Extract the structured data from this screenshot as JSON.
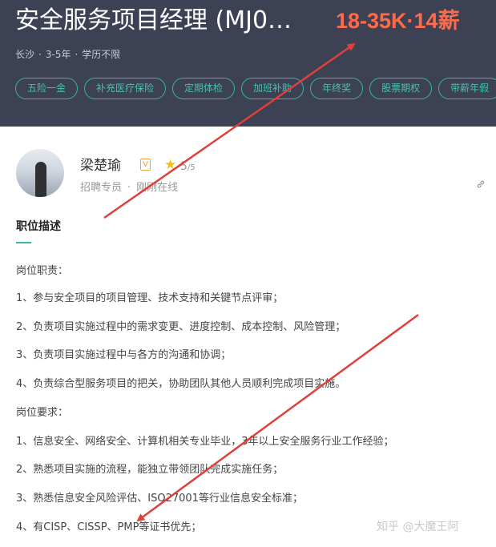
{
  "job": {
    "title": "安全服务项目经理 (MJ0…",
    "salary": "18-35K·14薪",
    "location": "长沙",
    "experience": "3-5年",
    "education": "学历不限"
  },
  "benefits": [
    "五险一金",
    "补充医疗保险",
    "定期体检",
    "加班补助",
    "年终奖",
    "股票期权",
    "带薪年假"
  ],
  "recruiter": {
    "name": "梁楚瑜",
    "rating": "5",
    "rating_max": "/5",
    "role": "招聘专员",
    "status": "刚刚在线"
  },
  "description": {
    "title": "职位描述",
    "lines": [
      "岗位职责：",
      "1、参与安全项目的项目管理、技术支持和关键节点评审；",
      "2、负责项目实施过程中的需求变更、进度控制、成本控制、风险管理；",
      "3、负责项目实施过程中与各方的沟通和协调；",
      "4、负责综合型服务项目的把关，协助团队其他人员顺利完成项目实施。",
      "岗位要求：",
      "1、信息安全、网络安全、计算机相关专业毕业，3年以上安全服务行业工作经验；",
      "2、熟悉项目实施的流程，能独立带领团队完成实施任务；",
      "3、熟悉信息安全风险评估、ISO27001等行业信息安全标准；",
      "4、有CISP、CISSP、PMP等证书优先；"
    ]
  },
  "watermark": "知乎 @大魔王阿",
  "colors": {
    "header_bg": "#3c4154",
    "salary": "#fe6a4a",
    "accent": "#38b5a3",
    "annotation_arrow": "#e0403a"
  },
  "icons": {
    "verify": "verified-badge-icon",
    "star": "star-icon",
    "link": "link-icon"
  }
}
